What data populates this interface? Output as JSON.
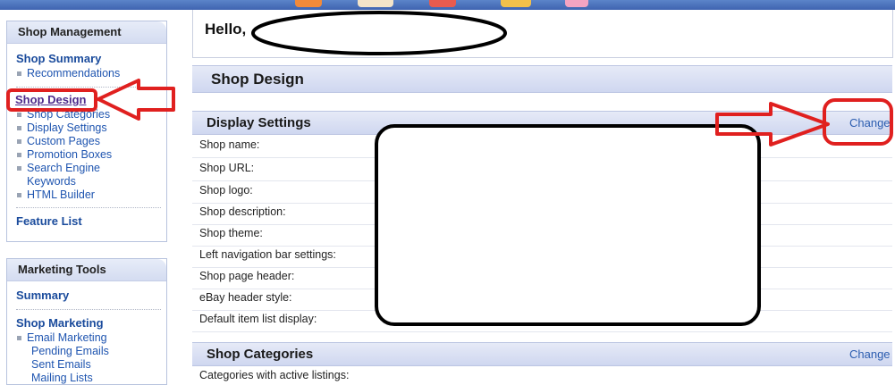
{
  "sidebar": {
    "shop_management": {
      "title": "Shop Management",
      "shop_summary": "Shop Summary",
      "recommendations": "Recommendations",
      "shop_design": "Shop Design",
      "items": [
        "Shop Categories",
        "Display Settings",
        "Custom Pages",
        "Promotion Boxes",
        "Search Engine",
        "Keywords",
        "HTML Builder"
      ],
      "feature_list": "Feature List"
    },
    "marketing_tools": {
      "title": "Marketing Tools",
      "summary": "Summary",
      "shop_marketing": "Shop Marketing",
      "email_marketing": "Email Marketing",
      "pending_emails": "Pending Emails",
      "sent_emails": "Sent Emails",
      "mailing_lists": "Mailing Lists"
    }
  },
  "main": {
    "greeting": "Hello,",
    "section_title": "Shop Design",
    "display_settings": {
      "title": "Display Settings",
      "change": "Change",
      "rows": [
        "Shop name:",
        "Shop URL:",
        "Shop logo:",
        "Shop description:",
        "Shop theme:",
        "Left navigation bar settings:",
        "Shop page header:",
        "eBay header style:",
        "Default item list display:"
      ]
    },
    "shop_categories": {
      "title": "Shop Categories",
      "change": "Change",
      "first_row": "Categories with active listings:"
    }
  },
  "colors": {
    "annotation_red": "#e0201f",
    "link_blue": "#1f55b0",
    "header_bar": "#d6ddf2"
  }
}
